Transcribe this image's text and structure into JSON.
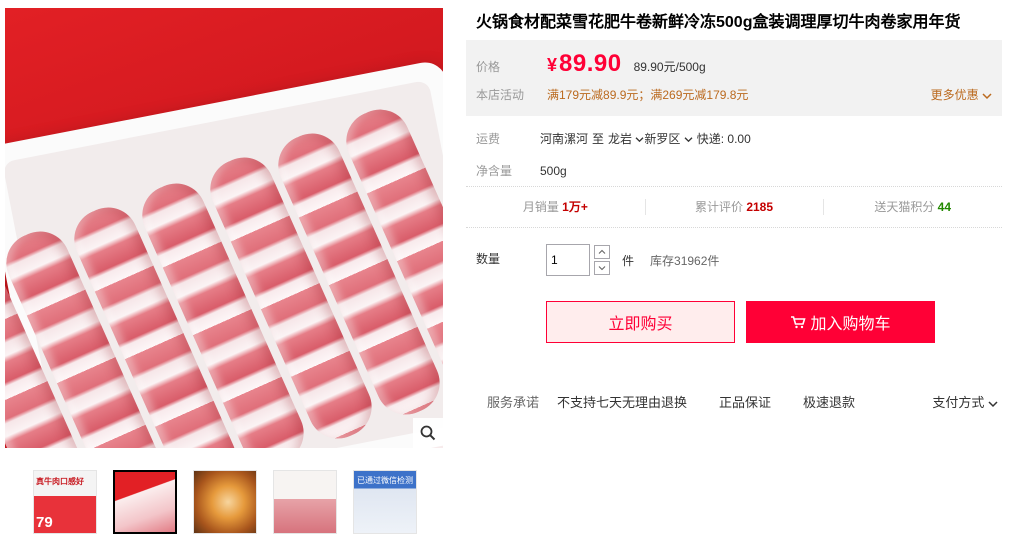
{
  "product": {
    "title": "火锅食材配菜雪花肥牛卷新鲜冷冻500g盒装调理厚切牛肉卷家用年货"
  },
  "price_box": {
    "price_label": "价格",
    "currency": "¥",
    "price": "89.90",
    "unit_price": "89.90元/500g",
    "promo_label": "本店活动",
    "promo_text": "满179元减89.9元；满269元减179.8元",
    "more_deals": "更多优惠"
  },
  "shipping": {
    "label": "运费",
    "origin": "河南漯河",
    "to": "至",
    "city": "龙岩",
    "district": "新罗区",
    "express": "快递: 0.00"
  },
  "net": {
    "label": "净含量",
    "value": "500g"
  },
  "stats": {
    "monthly_label": "月销量",
    "monthly_value": "1万+",
    "reviews_label": "累计评价",
    "reviews_value": "2185",
    "points_label": "送天猫积分",
    "points_value": "44"
  },
  "quantity": {
    "label": "数量",
    "value": "1",
    "unit": "件",
    "stock": "库存31962件"
  },
  "actions": {
    "buy_now": "立即购买",
    "add_to_cart": "加入购物车"
  },
  "service": {
    "label": "服务承诺",
    "items": [
      "不支持七天无理由退换",
      "正品保证",
      "极速退款"
    ],
    "payment": "支付方式"
  },
  "thumbnails": {
    "t1_caption": "真牛肉口感好",
    "t1_price": "79",
    "t5_caption": "已通过微信检测"
  },
  "icons": {
    "zoom": "magnifier-icon",
    "cart": "cart-icon",
    "chevron": "chevron-down-icon"
  },
  "colors": {
    "accent": "#ff0036",
    "promo": "#bb6a1f",
    "reviews": "#c40000",
    "points": "#228800"
  }
}
